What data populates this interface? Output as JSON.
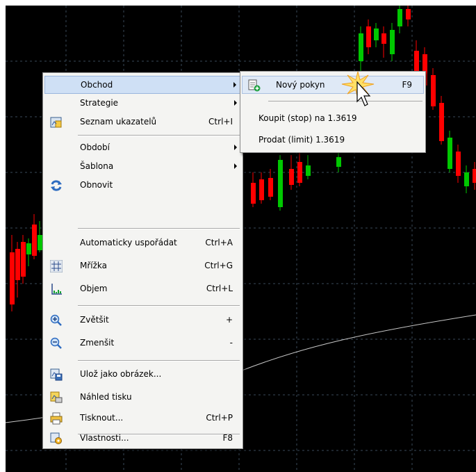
{
  "context_menu": {
    "items": [
      {
        "label": "Obchod",
        "shortcut": "",
        "submenu": true,
        "icon": ""
      },
      {
        "label": "Strategie",
        "shortcut": "",
        "submenu": true,
        "icon": ""
      },
      {
        "label": "Seznam ukazatelů",
        "shortcut": "Ctrl+I",
        "submenu": false,
        "icon": "indicator-list-icon"
      },
      {
        "label": "Období",
        "shortcut": "",
        "submenu": true,
        "icon": ""
      },
      {
        "label": "Šablona",
        "shortcut": "",
        "submenu": true,
        "icon": ""
      },
      {
        "label": "Obnovit",
        "shortcut": "",
        "submenu": false,
        "icon": "refresh-icon"
      },
      {
        "label": "Automaticky uspořádat",
        "shortcut": "Ctrl+A",
        "submenu": false,
        "icon": ""
      },
      {
        "label": "Mřížka",
        "shortcut": "Ctrl+G",
        "submenu": false,
        "icon": "grid-icon"
      },
      {
        "label": "Objem",
        "shortcut": "Ctrl+L",
        "submenu": false,
        "icon": "volume-icon"
      },
      {
        "label": "Zvětšit",
        "shortcut": "+",
        "submenu": false,
        "icon": "zoom-in-icon"
      },
      {
        "label": "Zmenšit",
        "shortcut": "-",
        "submenu": false,
        "icon": "zoom-out-icon"
      },
      {
        "label": "Ulož jako obrázek...",
        "shortcut": "",
        "submenu": false,
        "icon": "save-picture-icon"
      },
      {
        "label": "Náhled tisku",
        "shortcut": "",
        "submenu": false,
        "icon": "print-preview-icon"
      },
      {
        "label": "Tisknout...",
        "shortcut": "Ctrl+P",
        "submenu": false,
        "icon": "printer-icon"
      },
      {
        "label": "Vlastnosti...",
        "shortcut": "F8",
        "submenu": false,
        "icon": "properties-icon"
      }
    ]
  },
  "trade_submenu": {
    "items": [
      {
        "label": "Nový pokyn",
        "shortcut": "F9",
        "icon": "new-order-icon"
      },
      {
        "label": "Koupit (stop) na 1.3619",
        "shortcut": "",
        "icon": ""
      },
      {
        "label": "Prodat (limit)  1.3619",
        "shortcut": "",
        "icon": ""
      }
    ]
  },
  "colors": {
    "chart_background": "#000000",
    "bull_candle": "#00c800",
    "bear_candle": "#ff0000",
    "grid": "#3a4a5a",
    "moving_average": "#c8c8c8",
    "menu_background": "#f4f4f2",
    "menu_highlight": "#cfe0f5"
  }
}
